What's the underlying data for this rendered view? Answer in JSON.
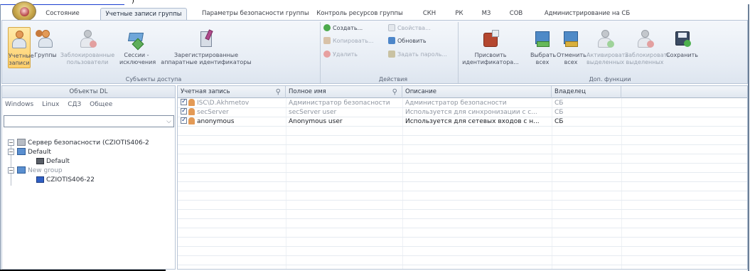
{
  "tabs": [
    {
      "label": "Состояние"
    },
    {
      "label": "Учетные записи группы"
    },
    {
      "label": "Параметры безопасности группы"
    },
    {
      "label": "Контроль ресурсов группы"
    },
    {
      "label": "СКН"
    },
    {
      "label": "РК"
    },
    {
      "label": "МЗ"
    },
    {
      "label": "СОВ"
    },
    {
      "label": "Администрирование на СБ"
    }
  ],
  "ribbon": {
    "subjects": {
      "accounts": "Учетные записи",
      "groups": "Группы",
      "blocked_users": "Заблокированные пользователи",
      "sessions": "Сессии - исключения",
      "registered_hw": "Зарегистрированные аппаратные идентификаторы",
      "group_label": "Субъекты доступа"
    },
    "actions": {
      "create": "Создать...",
      "copy": "Копировать...",
      "delete": "Удалить",
      "properties": "Свойства...",
      "refresh": "Обновить",
      "set_password": "Задать пароль...",
      "group_label": "Действия"
    },
    "extra": {
      "assign_ids": "Присвоить идентификатора...",
      "select_all": "Выбрать всех",
      "deselect_all": "Отменить всех",
      "activate_selected": "Активировать выделенных",
      "block_selected": "Заблокировать выделенных",
      "save": "Сохранить",
      "group_label": "Доп. функции"
    }
  },
  "left_panel": {
    "header": "Объекты DL",
    "tabs": [
      "Windows",
      "Linux",
      "СДЗ",
      "Общее"
    ],
    "combo_value": "",
    "tree": {
      "server": "Сервер безопасности (CZIOTIS406-2",
      "group_default": "Default",
      "computer_default": "Default",
      "group_new": "New group",
      "computer_new": "CZIOTIS406-22"
    }
  },
  "grid": {
    "columns": [
      "Учетная запись",
      "Полное имя",
      "Описание",
      "Владелец"
    ],
    "rows": [
      {
        "account": "ISC\\D.Akhmetov",
        "full_name": "Администратор безопасности",
        "description": "Администратор безопасности",
        "owner": "СБ"
      },
      {
        "account": "secServer",
        "full_name": "secServer user",
        "description": "Используется для синхронизации с с...",
        "owner": "СБ"
      },
      {
        "account": "anonymous",
        "full_name": "Anonymous user",
        "description": "Используется для сетевых входов с н...",
        "owner": "СБ"
      }
    ]
  },
  "colors": {
    "ribbon_bg": "#e6ecf4",
    "selected_button": "#ffcf6b",
    "link": "#1a3fd0"
  }
}
